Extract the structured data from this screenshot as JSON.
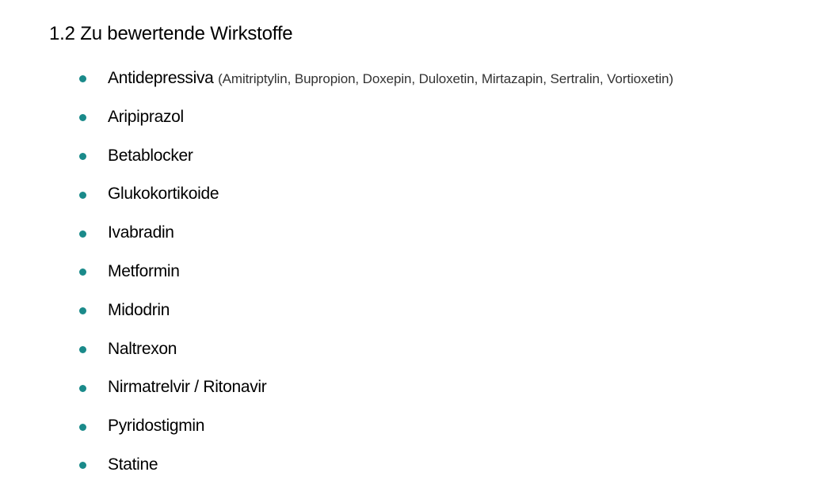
{
  "heading": "1.2 Zu bewertende Wirkstoffe",
  "accent_color": "#1a8a8a",
  "bullet_icon": "bullet-dot",
  "items": [
    {
      "name": "Antidepressiva",
      "detail": "(Amitriptylin, Bupropion, Doxepin, Duloxetin, Mirtazapin, Sertralin, Vortioxetin)"
    },
    {
      "name": "Aripiprazol"
    },
    {
      "name": "Betablocker"
    },
    {
      "name": "Glukokortikoide"
    },
    {
      "name": "Ivabradin"
    },
    {
      "name": "Metformin"
    },
    {
      "name": "Midodrin"
    },
    {
      "name": "Naltrexon"
    },
    {
      "name": "Nirmatrelvir / Ritonavir"
    },
    {
      "name": "Pyridostigmin"
    },
    {
      "name": "Statine"
    }
  ]
}
